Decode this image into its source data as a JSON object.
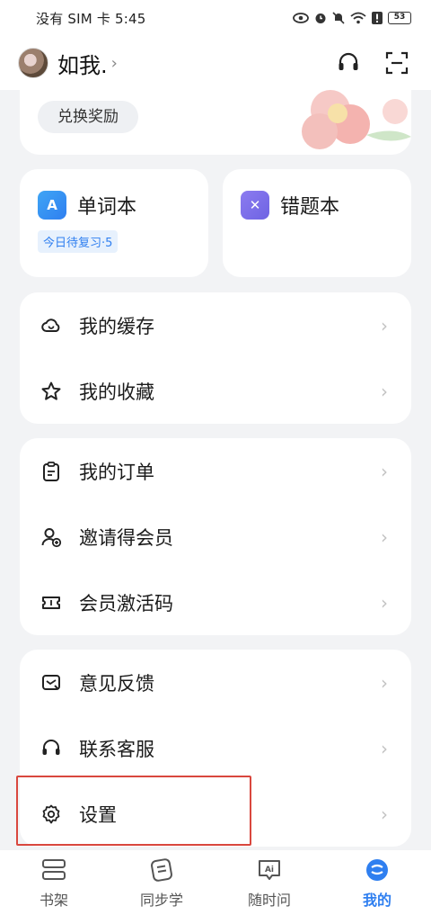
{
  "status_bar": {
    "carrier_time": "没有 SIM 卡 5:45",
    "battery": "53"
  },
  "header": {
    "user_name": "如我.",
    "icons": [
      "headset-icon",
      "scan-icon"
    ]
  },
  "reward": {
    "button_label": "兑换奖励"
  },
  "tiles": {
    "vocab": {
      "title": "单词本",
      "icon_letter": "A",
      "badge": "今日待复习·5"
    },
    "mistakes": {
      "title": "错题本",
      "icon_letter": "✕"
    }
  },
  "groups": {
    "g1": [
      {
        "label": "我的缓存",
        "icon": "cloud-icon"
      },
      {
        "label": "我的收藏",
        "icon": "star-icon"
      }
    ],
    "g2": [
      {
        "label": "我的订单",
        "icon": "clipboard-icon"
      },
      {
        "label": "邀请得会员",
        "icon": "add-user-icon"
      },
      {
        "label": "会员激活码",
        "icon": "ticket-icon"
      }
    ],
    "g3": [
      {
        "label": "意见反馈",
        "icon": "feedback-icon"
      },
      {
        "label": "联系客服",
        "icon": "headset-icon"
      },
      {
        "label": "设置",
        "icon": "gear-icon"
      }
    ]
  },
  "tab_bar": {
    "tabs": [
      {
        "label": "书架",
        "icon": "bookshelf-icon"
      },
      {
        "label": "同步学",
        "icon": "sync-learn-icon"
      },
      {
        "label": "随时问",
        "icon": "ai-chat-icon"
      },
      {
        "label": "我的",
        "icon": "profile-icon",
        "active": true
      }
    ]
  },
  "colors": {
    "accent": "#2f7ff0",
    "highlight": "#d9473e",
    "background": "#f2f3f5"
  }
}
